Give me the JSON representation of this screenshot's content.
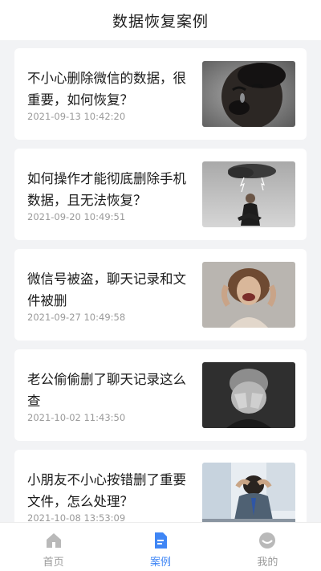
{
  "header": {
    "title": "数据恢复案例"
  },
  "cases": [
    {
      "title": "不小心删除微信的数据，很重要，如何恢复？",
      "date": "2021-09-13 10:42:20",
      "image": "crying-child-photo"
    },
    {
      "title": "如何操作才能彻底删除手机数据，且无法恢复？",
      "date": "2021-09-20 10:49:51",
      "image": "man-under-storm-cloud-photo"
    },
    {
      "title": "微信号被盗，聊天记录和文件被删",
      "date": "2021-09-27 10:49:58",
      "image": "screaming-woman-photo"
    },
    {
      "title": "老公偷偷删了聊天记录这么查",
      "date": "2021-10-02 11:43:50",
      "image": "boy-covering-face-photo"
    },
    {
      "title": "小朋友不小心按错删了重要文件，怎么处理？",
      "date": "2021-10-08 13:53:09",
      "image": "stressed-businessman-photo"
    }
  ],
  "tabbar": {
    "items": [
      {
        "label": "首页",
        "icon": "home-icon",
        "active": false
      },
      {
        "label": "案例",
        "icon": "document-icon",
        "active": true
      },
      {
        "label": "我的",
        "icon": "profile-icon",
        "active": false
      }
    ]
  },
  "colors": {
    "accent": "#3f86f5",
    "inactive": "#9b9b9b",
    "background": "#f2f3f5"
  }
}
